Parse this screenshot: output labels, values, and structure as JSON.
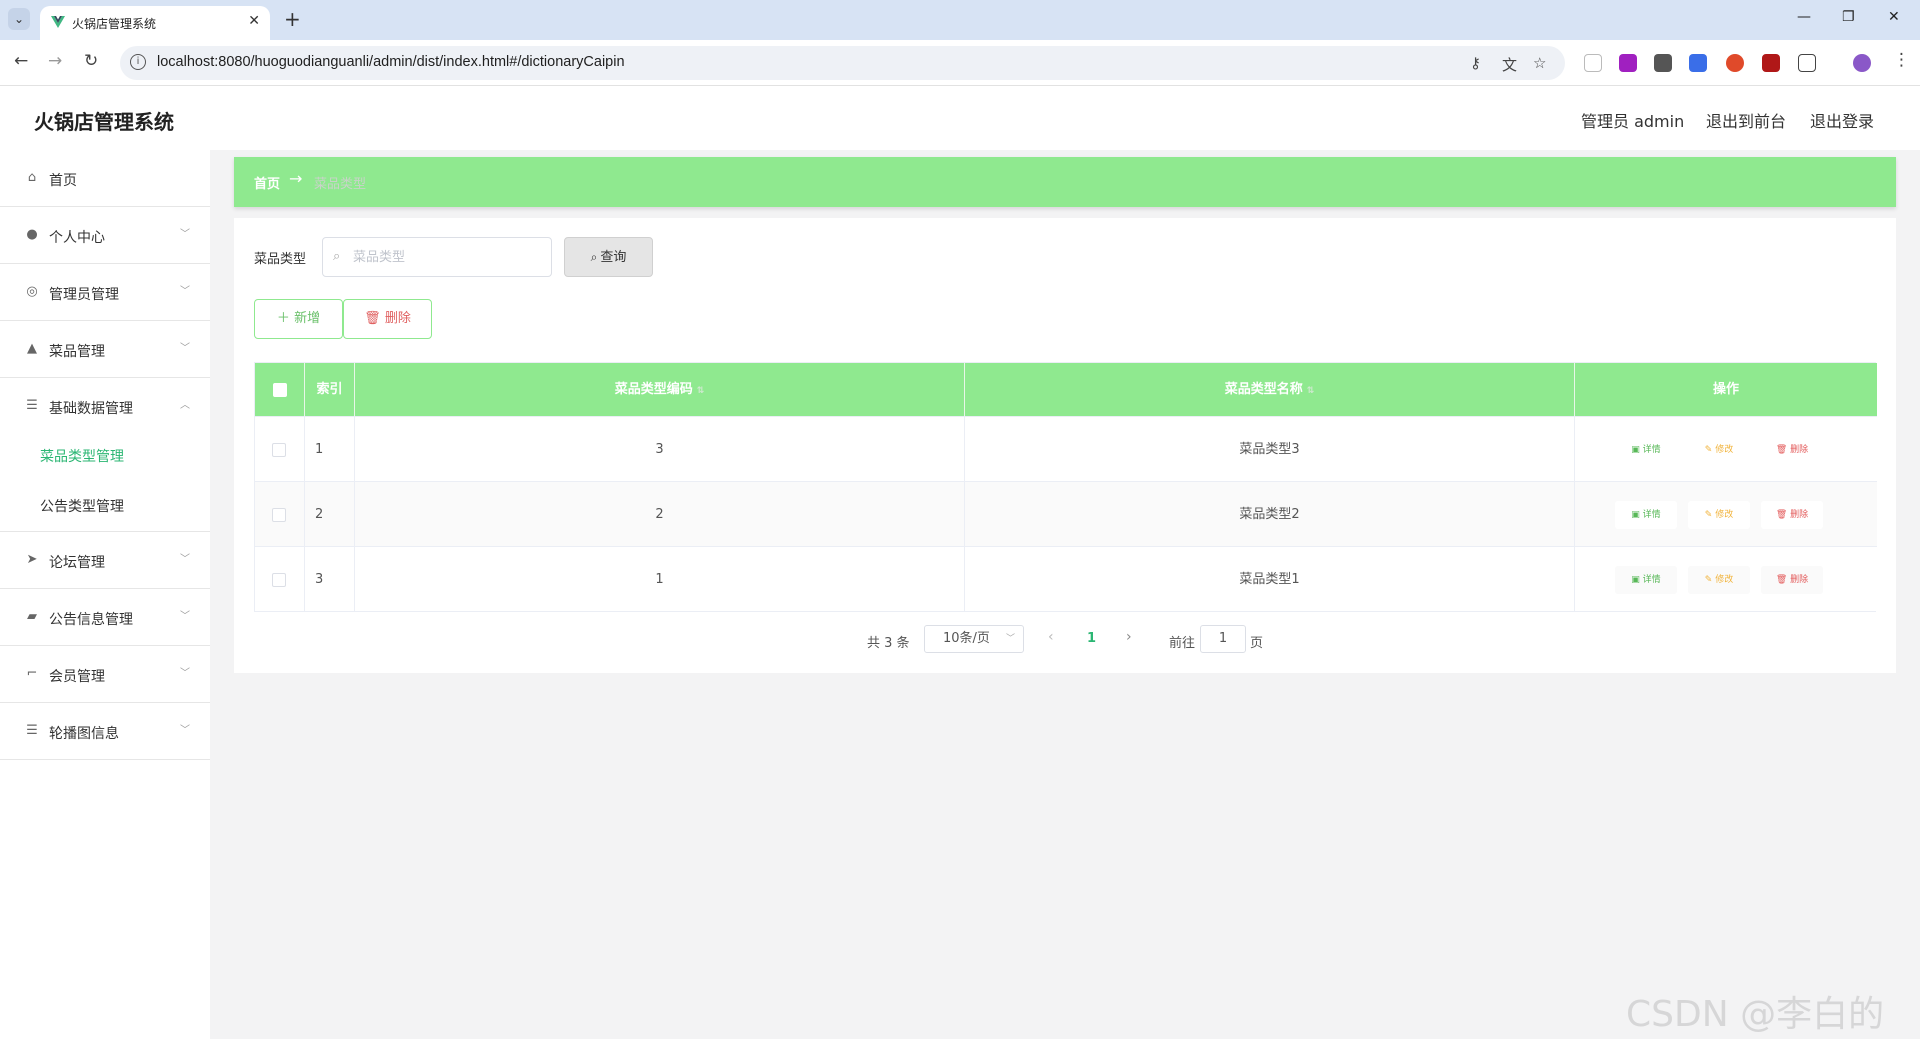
{
  "browser": {
    "tab_title": "火锅店管理系统",
    "url": "localhost:8080/huoguodianguanli/admin/dist/index.html#/dictionaryCaipin"
  },
  "header": {
    "title": "火锅店管理系统",
    "admin_label": "管理员 admin",
    "to_front": "退出到前台",
    "logout": "退出登录"
  },
  "sidebar": {
    "items": [
      {
        "label": "首页",
        "icon": "home-icon"
      },
      {
        "label": "个人中心",
        "icon": "user-icon"
      },
      {
        "label": "管理员管理",
        "icon": "compass-icon"
      },
      {
        "label": "菜品管理",
        "icon": "person-icon"
      },
      {
        "label": "基础数据管理",
        "icon": "list-icon"
      },
      {
        "label": "论坛管理",
        "icon": "send-icon"
      },
      {
        "label": "公告信息管理",
        "icon": "briefcase-icon"
      },
      {
        "label": "会员管理",
        "icon": "crop-icon"
      },
      {
        "label": "轮播图信息",
        "icon": "menu-icon"
      }
    ],
    "submenu": [
      {
        "label": "菜品类型管理",
        "active": true
      },
      {
        "label": "公告类型管理",
        "active": false
      }
    ]
  },
  "breadcrumb": {
    "home": "首页",
    "arrow": "→",
    "current": "菜品类型"
  },
  "search": {
    "label": "菜品类型",
    "placeholder": "菜品类型",
    "button": "查询"
  },
  "actions": {
    "add": "新增",
    "delete": "删除"
  },
  "table": {
    "headers": [
      "索引",
      "菜品类型编码",
      "菜品类型名称",
      "操作"
    ],
    "rows": [
      {
        "index": "1",
        "code": "3",
        "name": "菜品类型3"
      },
      {
        "index": "2",
        "code": "2",
        "name": "菜品类型2"
      },
      {
        "index": "3",
        "code": "1",
        "name": "菜品类型1"
      }
    ],
    "op_detail": "详情",
    "op_edit": "修改",
    "op_delete": "删除"
  },
  "pagination": {
    "total": "共 3 条",
    "page_size": "10条/页",
    "current_page": "1",
    "goto_label": "前往",
    "goto_value": "1",
    "page_suffix": "页"
  },
  "watermark": "CSDN @李白的粉",
  "colors": {
    "accent_green": "#8fe98f",
    "active_text": "#2bb673",
    "danger": "#e35a5a",
    "warning": "#f1b33b"
  }
}
